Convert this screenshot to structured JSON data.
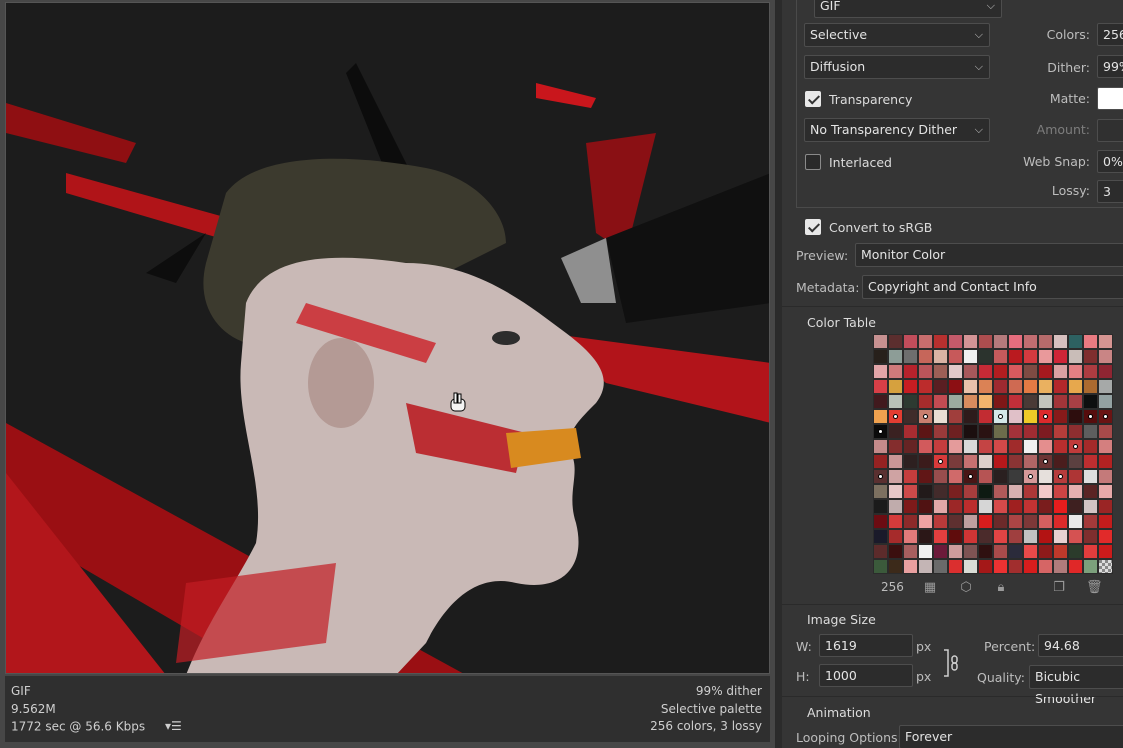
{
  "status": {
    "format": "GIF",
    "size": "9.562M",
    "time": "1772 sec @ 56.6 Kbps",
    "menu_icon": "optimize-menu-icon",
    "dither": "99% dither",
    "palette": "Selective palette",
    "colors_info": "256 colors, 3 lossy"
  },
  "settings": {
    "format_value": "GIF",
    "reduction_value": "Selective",
    "dither_algo_value": "Diffusion",
    "colors_label": "Colors:",
    "colors_value": "256",
    "dither_label": "Dither:",
    "dither_value": "99%",
    "transparency_label": "Transparency",
    "transparency_checked": true,
    "matte_label": "Matte:",
    "transparency_dither_value": "No Transparency Dither",
    "amount_label": "Amount:",
    "interlaced_label": "Interlaced",
    "interlaced_checked": false,
    "websnap_label": "Web Snap:",
    "websnap_value": "0%",
    "lossy_label": "Lossy:",
    "lossy_value": "3",
    "convert_srgb_label": "Convert to sRGB",
    "convert_srgb_checked": true,
    "preview_label": "Preview:",
    "preview_value": "Monitor Color",
    "metadata_label": "Metadata:",
    "metadata_value": "Copyright and Contact Info"
  },
  "color_table": {
    "title": "Color Table",
    "count": "256",
    "icons": [
      "map-to-transparent-icon",
      "web-shift-icon",
      "lock-color-icon",
      "new-color-icon",
      "delete-color-icon"
    ],
    "colors": [
      "#c79191",
      "#5b2e2e",
      "#c24d5b",
      "#c86d6d",
      "#b7302f",
      "#c45a6a",
      "#d49496",
      "#ad4d4f",
      "#b57a7c",
      "#e66d7e",
      "#c26d71",
      "#b66b6b",
      "#d7c0bf",
      "#2d6161",
      "#ea7b82",
      "#d69592",
      "#27201b",
      "#8d9d97",
      "#6e6e6e",
      "#c6665a",
      "#d9b3a4",
      "#c7595a",
      "#f0f0f0",
      "#2b332d",
      "#c65a5c",
      "#ba1a1f",
      "#d33a3f",
      "#e9999b",
      "#cf2537",
      "#c9bdb8",
      "#7f2e2e",
      "#c98585",
      "#e2a5a8",
      "#d07a7b",
      "#b7222c",
      "#bb555a",
      "#9c5f56",
      "#e2c9c9",
      "#a8585b",
      "#c62a36",
      "#b21d20",
      "#d95a5e",
      "#7e4b43",
      "#a6191f",
      "#daa1a2",
      "#e37f83",
      "#ad3c41",
      "#8f2532",
      "#d73f47",
      "#d6a13e",
      "#c71d22",
      "#bc2c2c",
      "#5a1e22",
      "#8c0f13",
      "#e8c1ab",
      "#db8255",
      "#9e2a30",
      "#cf6a52",
      "#e47a44",
      "#eab160",
      "#b3282b",
      "#e7a84d",
      "#ab6a2f",
      "#a6a9a8",
      "#411a1e",
      "#b8c1b6",
      "#2d3a31",
      "#a62c2c",
      "#c34b52",
      "#9cab9f",
      "#d78c5e",
      "#f2b46c",
      "#7e1717",
      "#c02f39",
      "#4a3a36",
      "#c2c4bc",
      "#a23539",
      "#a74045",
      "#0d0f0f",
      "#94a2a2",
      "#f0a24f",
      "#e33d32",
      "#3f2c2a",
      "#c97f6f",
      "#e8ded3",
      "#a03e3c",
      "#2e1b1b",
      "#c22c32",
      "#d4e8e8",
      "#e0c0c8",
      "#eecb27",
      "#dd2a2c",
      "#871a1a",
      "#2d0d0d",
      "#560d0d",
      "#6a1414",
      "#0b0b0b",
      "#3a2121",
      "#a82c31",
      "#5c1515",
      "#993a3a",
      "#6e2021",
      "#1b0f0f",
      "#2a1212",
      "#6c6c4b",
      "#a4323a",
      "#9f2c32",
      "#7d1b21",
      "#b53d3a",
      "#8e2e30",
      "#5e5e5e",
      "#a74a4a",
      "#c48a8a",
      "#842d2d",
      "#662424",
      "#d25a5c",
      "#c43d3e",
      "#e49b9b",
      "#d8d8d8",
      "#c44444",
      "#d24949",
      "#a02b2b",
      "#f0f0f0",
      "#e48e8e",
      "#b82e2e",
      "#c13b3b",
      "#a42a2a",
      "#d47f7f",
      "#952222",
      "#ca9696",
      "#2d2020",
      "#3b1b1b",
      "#d83a3a",
      "#7a3b3b",
      "#c57171",
      "#ddd0ca",
      "#b6181b",
      "#8a3434",
      "#b06565",
      "#6c3434",
      "#4a1d1d",
      "#5b4040",
      "#be2e30",
      "#b22222",
      "#5a3030",
      "#cfa3a3",
      "#c43d3d",
      "#611616",
      "#984d4d",
      "#d06a6a",
      "#481616",
      "#b65454",
      "#2a2020",
      "#3b3b3b",
      "#d69999",
      "#e6e0dc",
      "#b63c3c",
      "#ae3535",
      "#dedede",
      "#c47a7a",
      "#7c7060",
      "#e7c7c7",
      "#cd4a4a",
      "#221a1a",
      "#432b2b",
      "#7a2020",
      "#a73d3d",
      "#0e1a12",
      "#b15a5a",
      "#d8b0b0",
      "#ad3737",
      "#f2c8c8",
      "#cc4444",
      "#e5b0b0",
      "#5a2424",
      "#e7a9a9",
      "#1b1b1b",
      "#c0acac",
      "#7e1a1a",
      "#501212",
      "#e1a8a8",
      "#9c2727",
      "#bb2d2d",
      "#d6d6d6",
      "#d54a4a",
      "#a02020",
      "#c23333",
      "#7a1d1d",
      "#e71d1d",
      "#3e2020",
      "#d2c4c4",
      "#9a2525",
      "#6c0c12",
      "#d53b3b",
      "#8d2a2a",
      "#eea3a3",
      "#b93a3a",
      "#5e3030",
      "#bfa0a0",
      "#d81d1d",
      "#6b2a2a",
      "#ac4545",
      "#7e3838",
      "#d65f5f",
      "#dc2a2a",
      "#eaeaea",
      "#a33a3a",
      "#c31c1c",
      "#1a1a2a",
      "#a62b2b",
      "#e17a7a",
      "#2b1717",
      "#e33f3f",
      "#5f0c0c",
      "#cf3535",
      "#4b2b2b",
      "#e14444",
      "#9f3f3f",
      "#c2c2c2",
      "#b31313",
      "#e7d1d1",
      "#d55252",
      "#7e2e2e",
      "#e12a2a",
      "#5c2b2b",
      "#3b0f0f",
      "#a75f5f",
      "#f1f1f1",
      "#6c1a3a",
      "#ce9c9c",
      "#7e5353",
      "#2f1010",
      "#a94b4b",
      "#2b2b3b",
      "#ea4a4a",
      "#8d1a1a",
      "#c0392b",
      "#2b3b2b",
      "#e23d3d",
      "#cc1b1b",
      "#3b5a3b",
      "#3c2a1a",
      "#e9a0a0",
      "#c4b5b5",
      "#6a6a6a",
      "#db2f2f",
      "#d9dcd5",
      "#a41818",
      "#ec3232",
      "#a12e2e",
      "#d71d1d",
      "#d66565",
      "#b07b7b",
      "#e02828",
      "#7ca07c",
      "#cccccc"
    ],
    "dotted_indices": [
      96,
      81,
      83,
      88,
      91,
      94,
      95,
      125,
      132,
      144,
      139,
      150,
      154,
      156
    ]
  },
  "image_size": {
    "title": "Image Size",
    "w_label": "W:",
    "w_value": "1619",
    "h_label": "H:",
    "h_value": "1000",
    "unit": "px",
    "percent_label": "Percent:",
    "percent_value": "94.68",
    "quality_label": "Quality:",
    "quality_value": "Bicubic Smoother"
  },
  "animation": {
    "title": "Animation",
    "looping_label": "Looping Options:",
    "looping_value": "Forever"
  }
}
